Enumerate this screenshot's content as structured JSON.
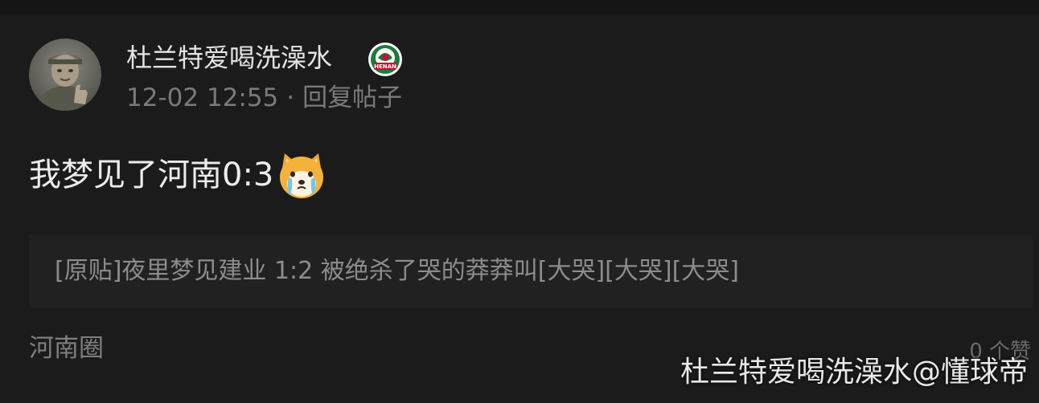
{
  "post": {
    "username": "杜兰特爱喝洗澡水",
    "team_badge_text": "HENAN",
    "timestamp": "12-02 12:55",
    "separator": "·",
    "reply_label": "回复帖子",
    "content": "我梦见了河南0:3",
    "emoji": "crying-shiba-dog",
    "quoted_post": "[原贴]夜里梦见建业 1:2 被绝杀了哭的莽莽叫[大哭][大哭][大哭]",
    "circle": "河南圈",
    "likes": "0 个赞"
  },
  "watermark": "杜兰特爱喝洗澡水@懂球帝",
  "colors": {
    "background": "#1b1b1b",
    "quote_background": "#212121",
    "primary_text": "#ececec",
    "secondary_text": "#7a7a7a",
    "badge_green": "#1e7a3c",
    "badge_red": "#c8102e"
  }
}
